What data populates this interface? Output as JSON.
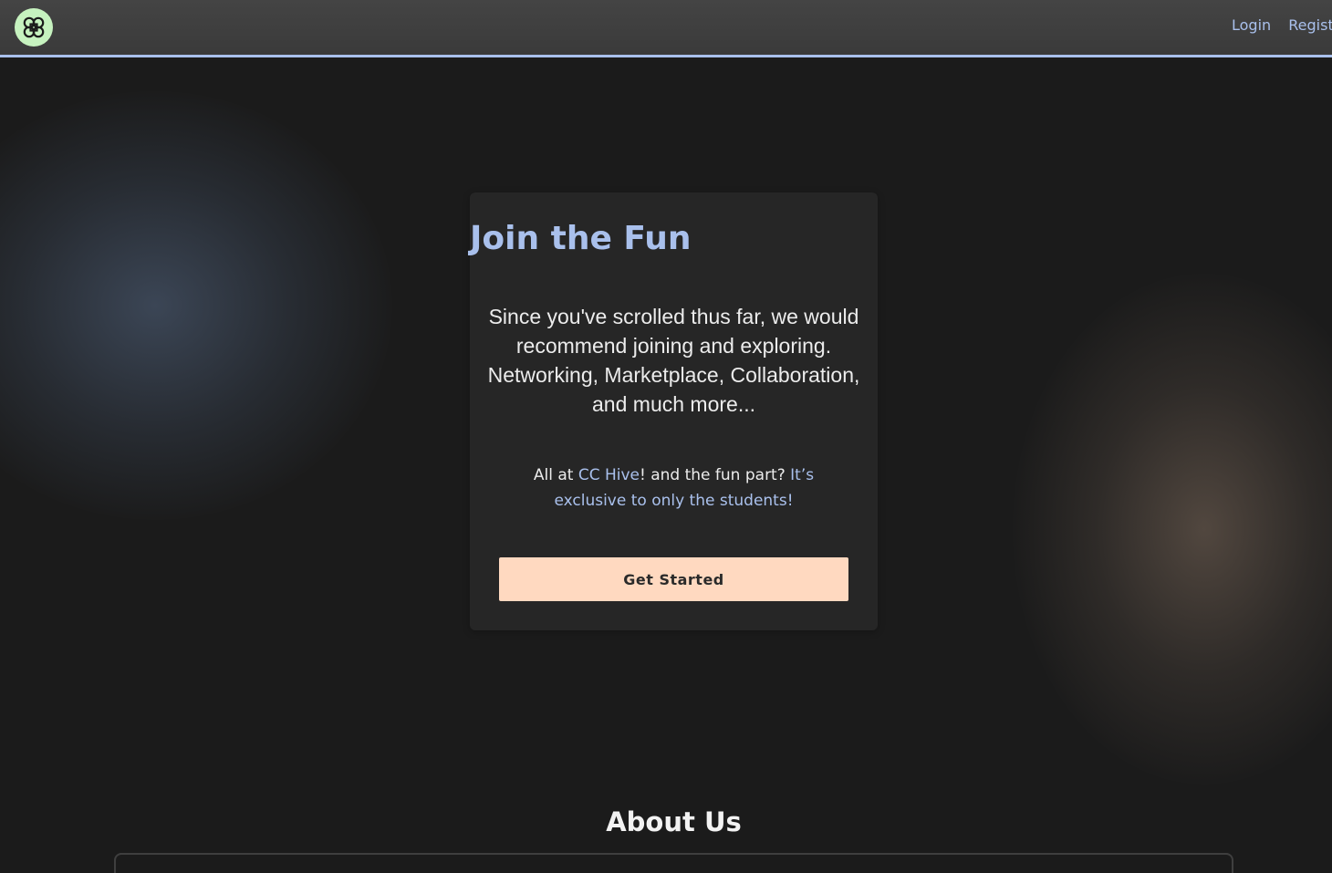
{
  "nav": {
    "logo_icon": "hive-logo-icon",
    "links": [
      {
        "label": "Login"
      },
      {
        "label": "Register"
      }
    ]
  },
  "card": {
    "title": "Join the Fun",
    "body": "Since you've scrolled thus far, we would recommend joining and exploring. Networking, Marketplace, Collaboration, and much more...",
    "note": {
      "prefix": "All at ",
      "brand": "CC Hive",
      "middle": "! and the fun part? ",
      "highlight": "It’s exclusive to only the students!"
    },
    "cta_label": "Get Started"
  },
  "about": {
    "title": "About Us"
  },
  "colors": {
    "accent": "#a9c0ec",
    "cta_background": "#ffd9c0",
    "page_background": "#1b1b1b",
    "logo_background": "#c6f2bf"
  }
}
